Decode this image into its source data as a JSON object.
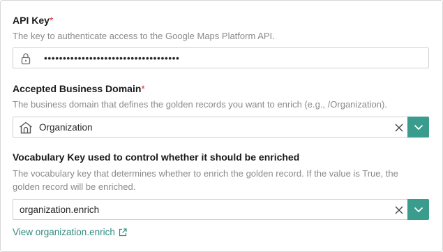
{
  "api_key": {
    "label": "API Key",
    "required_mark": "*",
    "help": "The key to authenticate access to the Google Maps Platform API.",
    "value_masked": "••••••••••••••••••••••••••••••••••••"
  },
  "business_domain": {
    "label": "Accepted Business Domain",
    "required_mark": "*",
    "help": "The business domain that defines the golden records you want to enrich (e.g., /Organization).",
    "value": "Organization"
  },
  "vocabulary_key": {
    "label": "Vocabulary Key used to control whether it should be enriched",
    "help": "The vocabulary key that determines whether to enrich the golden record. If the value is True, the golden record will be enriched.",
    "value": "organization.enrich",
    "link_text": "View organization.enrich"
  },
  "colors": {
    "accent": "#3a9c8c",
    "link": "#2e8b7f",
    "required": "#d13438",
    "help_text": "#8a8a8a"
  },
  "icons": [
    "lock-icon",
    "building-icon",
    "clear-icon",
    "chevron-down-icon",
    "external-link-icon"
  ]
}
